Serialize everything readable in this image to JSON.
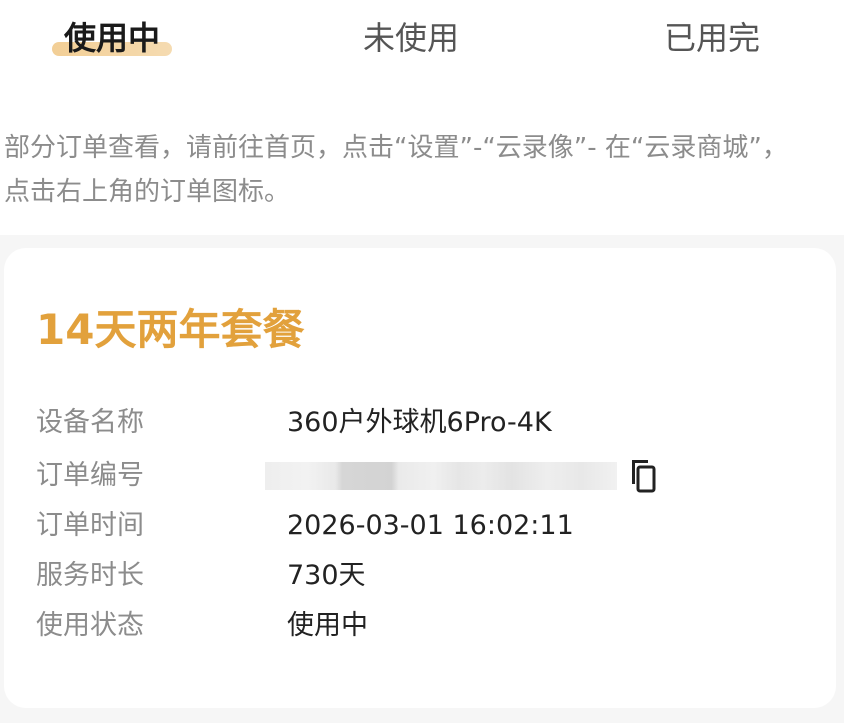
{
  "tabs": [
    {
      "label": "使用中",
      "active": true
    },
    {
      "label": "未使用",
      "active": false
    },
    {
      "label": "已用完",
      "active": false
    }
  ],
  "notice": "部分订单查看，请前往首页，点击“设置”-“云录像”- 在“云录商城”，点击右上角的订单图标。",
  "order": {
    "title": "14天两年套餐",
    "rows": [
      {
        "label": "设备名称",
        "value": "360户外球机6Pro-4K"
      },
      {
        "label": "订单编号",
        "value": ""
      },
      {
        "label": "订单时间",
        "value": "2026-03-01 16:02:11"
      },
      {
        "label": "服务时长",
        "value": "730天"
      },
      {
        "label": "使用状态",
        "value": "使用中"
      }
    ],
    "copy_icon": "copy-icon"
  },
  "colors": {
    "accent": "#e2a13c",
    "tab_indicator": "#f1c98a",
    "label": "#8c8c8c",
    "value": "#222222"
  }
}
